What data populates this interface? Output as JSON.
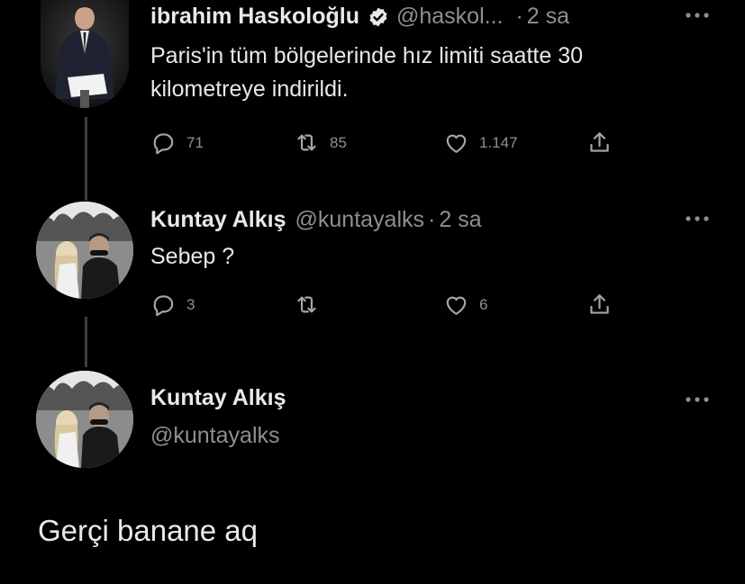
{
  "tweets": [
    {
      "name": "ibrahim Haskoloğlu",
      "verified": true,
      "handle": "@haskol...",
      "dot": "·",
      "time": "2 sa",
      "text_lines": [
        "Paris'in tüm bölgelerinde hız limiti saatte 30",
        "kilometreye indirildi."
      ],
      "replies": "71",
      "retweets": "85",
      "likes": "1.147"
    },
    {
      "name": "Kuntay Alkış",
      "handle": "@kuntayalks",
      "dot": "·",
      "time": "2 sa",
      "text_lines": [
        "Sebep ?"
      ],
      "replies": "3",
      "retweets": "",
      "likes": "6"
    }
  ],
  "main_tweet": {
    "name": "Kuntay Alkış",
    "handle": "@kuntayalks",
    "text": "Gerçi banane aq"
  },
  "colors": {
    "background": "#000000",
    "text_primary": "#e7e9ea",
    "text_secondary": "#8b9096",
    "verified_badge": "#e7e9ea",
    "thread_line": "#3a3d41"
  },
  "icons": {
    "reply": "reply-icon",
    "retweet": "retweet-icon",
    "like": "like-icon",
    "share": "share-icon",
    "more": "more-icon",
    "verified": "verified-badge-icon"
  }
}
